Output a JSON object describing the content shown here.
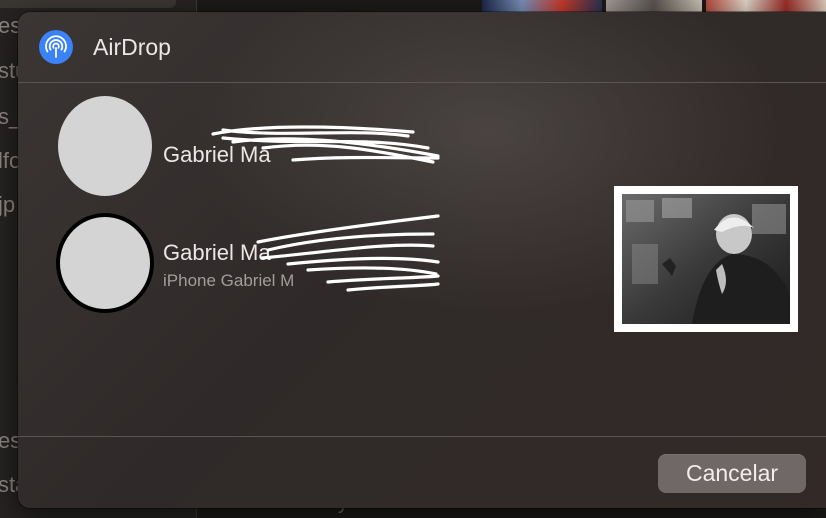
{
  "background": {
    "file_fragments": [
      "es",
      "stu",
      "s_",
      "lfo",
      "jp",
      "es",
      "sta"
    ],
    "bottom_fragment": "y"
  },
  "sheet": {
    "title": "AirDrop",
    "title_icon": "airdrop-icon",
    "accent": "#3b82f6"
  },
  "devices": [
    {
      "name": "Gabriel Ma",
      "subtitle": ""
    },
    {
      "name": "Gabriel Ma",
      "subtitle": "iPhone Gabriel M"
    }
  ],
  "preview": {
    "icon": "photo-thumbnail"
  },
  "buttons": {
    "cancel_label": "Cancelar"
  }
}
